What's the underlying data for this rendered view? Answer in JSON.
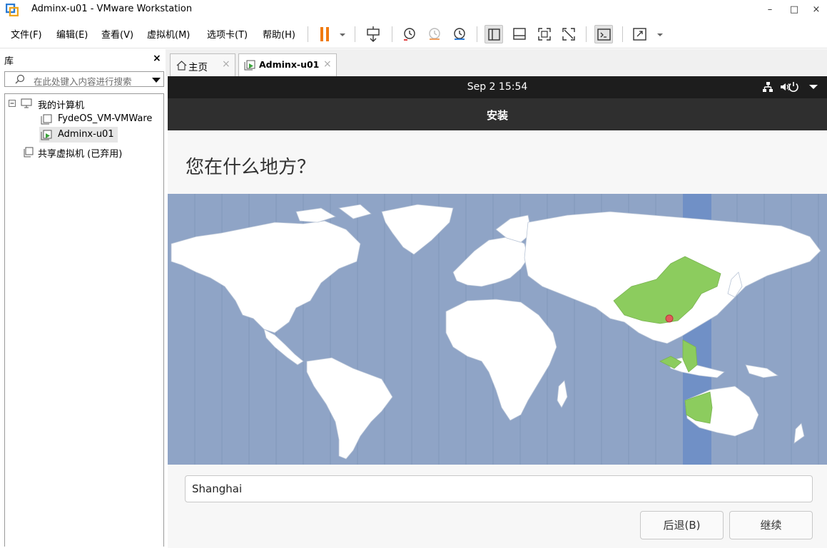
{
  "window": {
    "title": "Adminx-u01 - VMware Workstation",
    "controls": {
      "minimize": "–",
      "maximize": "□",
      "close": "×"
    }
  },
  "menu": {
    "file": "文件(F)",
    "edit": "编辑(E)",
    "view": "查看(V)",
    "vm": "虚拟机(M)",
    "tabs": "选项卡(T)",
    "help": "帮助(H)"
  },
  "toolbar": {
    "icons": [
      "pause-icon",
      "dropdown-arrow-icon",
      "send-ctrl-alt-del-icon",
      "snapshot-icon",
      "revert-snapshot-icon",
      "snapshot-manager-icon",
      "show-library-icon",
      "thumbnail-bar-icon",
      "full-screen-icon",
      "unity-icon",
      "console-view-icon",
      "stretch-icon"
    ]
  },
  "library": {
    "header": "库",
    "close": "×",
    "search_placeholder": "在此处键入内容进行搜索",
    "tree": {
      "root": "我的计算机",
      "vm1": "FydeOS_VM-VMWare",
      "vm2": "Adminx-u01",
      "shared": "共享虚拟机 (已弃用)"
    }
  },
  "tabs": [
    {
      "label": "主页",
      "close": "×"
    },
    {
      "label": "Adminx-u01",
      "close": "×"
    }
  ],
  "guest": {
    "clock": "Sep 2  15:54",
    "installer_title": "安装",
    "question": "您在什么地方？",
    "timezone_value": "Shanghai",
    "back_button": "后退(B)",
    "continue_button": "继续",
    "map": {
      "ocean_color": "#8fa4c6",
      "land_color": "#ffffff",
      "highlight_color": "#8ccc5e",
      "timezone_band_color": "#7090c6",
      "pin_color": "#e25a5a"
    }
  }
}
